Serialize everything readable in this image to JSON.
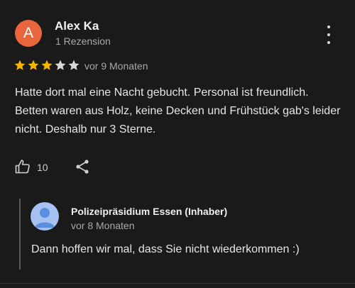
{
  "review": {
    "avatar_letter": "A",
    "author": "Alex Ka",
    "author_sub": "1 Rezension",
    "rating": 3,
    "rating_max": 5,
    "time": "vor 9 Monaten",
    "text": "Hatte dort mal eine Nacht gebucht. Personal ist freundlich. Betten waren aus Holz, keine Decken und Frühstück gab's leider nicht. Deshalb nur 3 Sterne.",
    "likes": "10"
  },
  "reply": {
    "name": "Polizeipräsidium Essen (Inhaber)",
    "time": "vor 8 Monaten",
    "text": "Dann hoffen wir mal, dass Sie nicht wiederkommen :)"
  },
  "colors": {
    "background": "#1a1a1a",
    "avatar": "#e8663d",
    "star_filled": "#f4b400",
    "star_empty": "#d9d9d9",
    "reply_avatar": "#a6c1f2"
  },
  "icons": {
    "more": "more-vertical-icon",
    "like": "thumbs-up-icon",
    "share": "share-icon",
    "reply_avatar": "default-person-icon"
  }
}
